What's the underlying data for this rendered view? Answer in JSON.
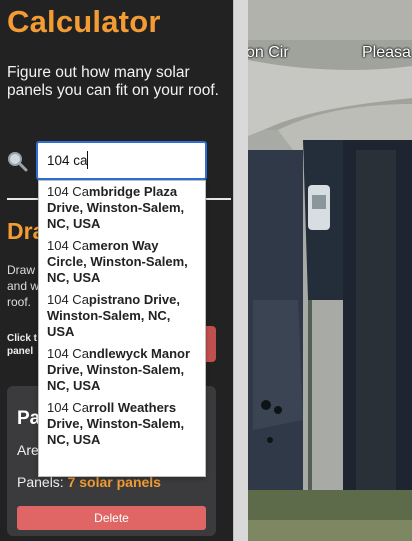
{
  "sidebar": {
    "title": "Calculator",
    "subtitle": "Figure out how many solar panels you can fit on your roof.",
    "search_icon": "magnifier-icon",
    "search_value": "104 ca",
    "section_heading": "Dra",
    "section_text": "Draw\nand w\nroof.",
    "click_text": "Click t\npanel",
    "panel_card": {
      "title": "Pa",
      "area_label": "Are",
      "panels_label": "Panels:",
      "panels_value": "7 solar panels",
      "delete_label": "Delete"
    }
  },
  "autocomplete": {
    "typed": "104 Ca",
    "suggestions": [
      {
        "match": "104 Ca",
        "rest": "mbridge Plaza Drive, Winston-Salem, NC, USA"
      },
      {
        "match": "104 Ca",
        "rest": "meron Way Circle, Winston-Salem, NC, USA"
      },
      {
        "match": "104 Ca",
        "rest": "pistrano Drive, Winston-Salem, NC, USA"
      },
      {
        "match": "104 Ca",
        "rest": "ndlewyck Manor Drive, Winston-Salem, NC, USA"
      },
      {
        "match": "104 Ca",
        "rest": "rroll Weathers Drive, Winston-Salem, NC, USA"
      }
    ]
  },
  "map": {
    "street_labels": [
      "on Cir",
      "Pleasa"
    ]
  },
  "colors": {
    "accent": "#f39c33",
    "panel_bg": "#222222",
    "input_border": "#2f6fd3",
    "delete_button": "#e06666"
  }
}
